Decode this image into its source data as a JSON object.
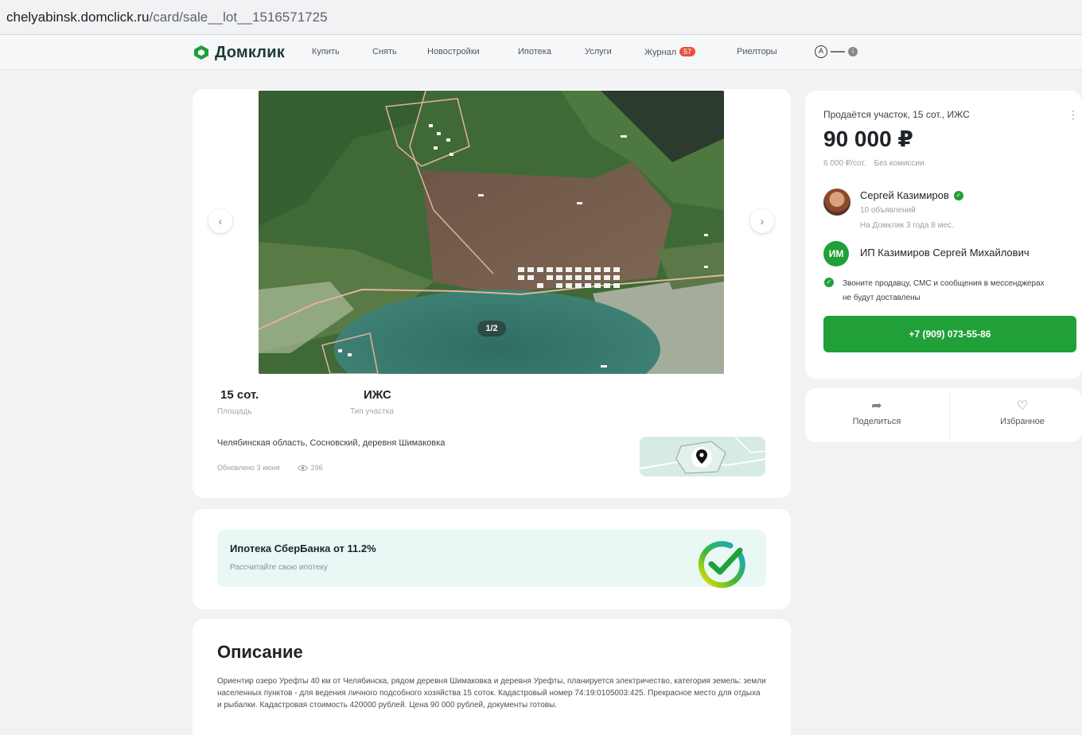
{
  "browser": {
    "url_host": "chelyabinsk.domclick.ru",
    "url_path": "/card/sale__lot__1516571725"
  },
  "nav": {
    "logo": "Домклик",
    "items": [
      "Купить",
      "Снять",
      "Новостройки",
      "Ипотека",
      "Услуги",
      "Журнал",
      "Риелторы"
    ],
    "journal_badge": "57"
  },
  "gallery": {
    "counter": "1/2",
    "prev_icon": "chevron-left-icon",
    "next_icon": "chevron-right-icon"
  },
  "attributes": [
    {
      "value": "15 сот.",
      "label": "Площадь"
    },
    {
      "value": "ИЖС",
      "label": "Тип участка"
    }
  ],
  "location": {
    "address": "Челябинская область, Сосновский, деревня Шимаковка",
    "updated": "Обновлено 3 июня",
    "views": "296"
  },
  "mortgage": {
    "title": "Ипотека СберБанка от 11.2%",
    "subtitle": "Рассчитайте свою ипотеку"
  },
  "description": {
    "title": "Описание",
    "text": "Ориентир озеро Урефты 40 км от Челябинска, рядом деревня Шимаковка и деревня Урефты, планируется электричество, категория земель: земли населенных пунктов - для ведения личного подсобного хозяйства 15 соток. Кадастровый номер 74:19:0105003:425. Прекрасное место для отдыха и рыбалки. Кадастровая стоимость 420000 рублей. Цена 90 000 рублей, документы готовы."
  },
  "offer": {
    "title": "Продаётся участок, 15 сот., ИЖС",
    "price": "90 000 ₽",
    "price_per_unit": "6 000 ₽/сот.",
    "commission": "Без комиссии",
    "seller_name": "Сергей Казимиров",
    "seller_ads": "10 объявлений",
    "seller_since": "На Домклик 3 года 8 мес.",
    "company_initials": "ИМ",
    "company_name": "ИП Казимиров Сергей Михайлович",
    "notice": "Звоните продавцу, СМС и сообщения в мессенджерах не будут доставлены",
    "phone": "+7 (909) 073-55-86"
  },
  "actions": {
    "share": "Поделиться",
    "favorite": "Избранное"
  },
  "colors": {
    "accent": "#21a038",
    "badge": "#e8533f",
    "mortgage_bg": "#e9f7f5"
  }
}
